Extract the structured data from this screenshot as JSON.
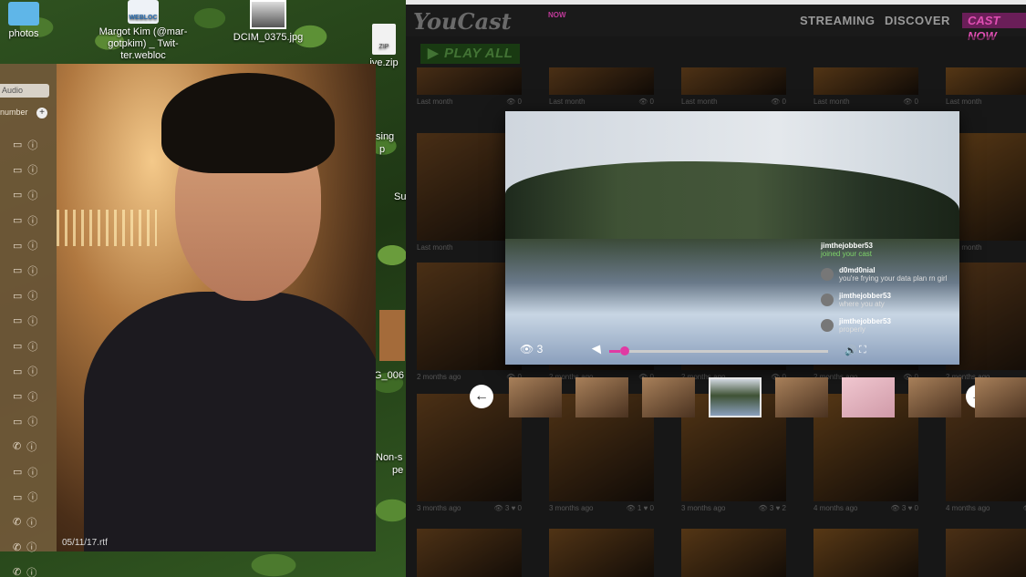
{
  "desktop": {
    "icons": [
      {
        "label": "photos",
        "kind": "folder"
      },
      {
        "label": "Margot Kim (@mar-gotpkim) _ Twit-ter.webloc",
        "kind": "webloc",
        "badge": "WEBLOC"
      },
      {
        "label": "DCIM_0375.jpg",
        "kind": "photo"
      },
      {
        "label": "ive.zip",
        "kind": "zip",
        "badge": "ZIP"
      }
    ],
    "partial_labels": [
      "sing",
      "p",
      "Su",
      "G_006",
      "Non-s",
      "pe"
    ]
  },
  "sidebar": {
    "audio_button": "Audio",
    "number_label": "number",
    "plus": "+",
    "rows": [
      {
        "icon": "video-icon"
      },
      {
        "icon": "video-icon"
      },
      {
        "icon": "video-icon"
      },
      {
        "icon": "video-icon"
      },
      {
        "icon": "video-icon"
      },
      {
        "icon": "video-icon"
      },
      {
        "icon": "video-icon"
      },
      {
        "icon": "video-icon"
      },
      {
        "icon": "video-icon"
      },
      {
        "icon": "video-icon"
      },
      {
        "icon": "video-icon"
      },
      {
        "icon": "video-icon"
      },
      {
        "icon": "phone-icon"
      },
      {
        "icon": "video-icon"
      },
      {
        "icon": "video-icon"
      },
      {
        "icon": "phone-icon"
      },
      {
        "icon": "phone-icon"
      },
      {
        "icon": "phone-icon"
      }
    ]
  },
  "webcam": {
    "timestamp": "05/11/17.rtf"
  },
  "youcast": {
    "logo": "YouCast",
    "logo_badge": "NOW",
    "nav": [
      "STREAMING",
      "DISCOVER"
    ],
    "nav_active": "CAST NOW",
    "play_all": "PLAY ALL",
    "play_icon": "▶",
    "rows": [
      {
        "when": "Last month",
        "views": "0"
      },
      {
        "when": "Last month",
        "views": "0"
      },
      {
        "when": "2 months ago",
        "views": "0"
      },
      {
        "when": "3 months ago",
        "views": "0"
      }
    ],
    "tile_meta": [
      "3 months ago",
      "3 months ago",
      "3 months ago",
      "4 months ago",
      "4 months ago"
    ],
    "tile_counts": [
      {
        "views": "3",
        "likes": "0"
      },
      {
        "views": "1",
        "likes": "0"
      },
      {
        "views": "3",
        "likes": "2"
      },
      {
        "views": "3",
        "likes": "0"
      },
      {
        "views": "3",
        "likes": "0"
      }
    ],
    "colors": {
      "accent": "#e03aa3",
      "play_all": "#79d160"
    }
  },
  "player": {
    "view_count": "3",
    "progress_fraction": 0.05,
    "chat": [
      {
        "user": "jimthejobber53",
        "msg": "joined your cast",
        "type": "join"
      },
      {
        "user": "d0md0nial",
        "msg": "you're frying your data plan rn girl",
        "type": "msg"
      },
      {
        "user": "jimthejobber53",
        "msg": "where you aty",
        "type": "msg"
      },
      {
        "user": "jimthejobber53",
        "msg": "properly",
        "type": "msg"
      }
    ]
  },
  "carousel": {
    "prev": "←",
    "next": "→",
    "count": 8,
    "active_index": 3
  }
}
